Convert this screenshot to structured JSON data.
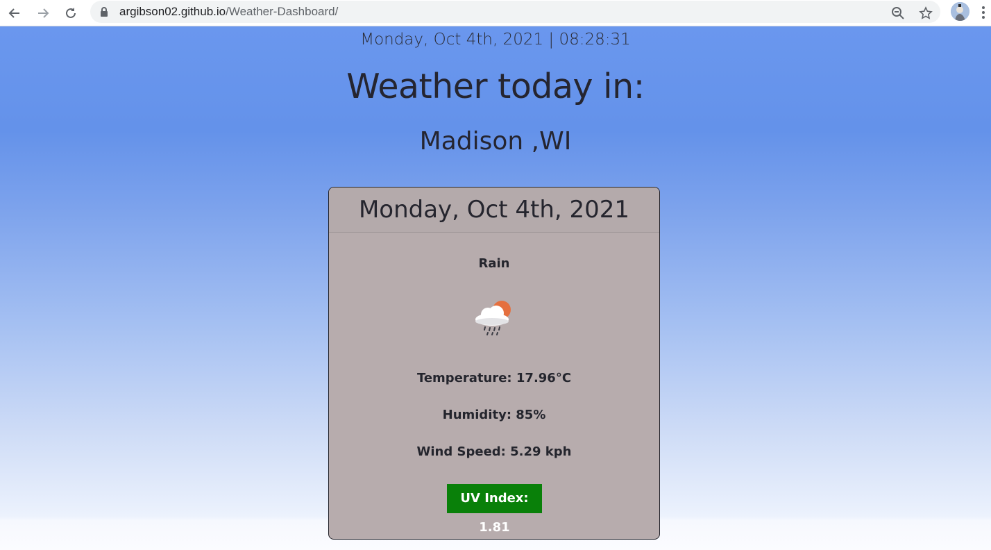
{
  "browser": {
    "url_domain": "argibson02.github.io",
    "url_path": "/Weather-Dashboard/"
  },
  "page": {
    "clock": "Monday, Oct 4th, 2021 | 08:28:31",
    "heading": "Weather today in:",
    "city": "Madison ,WI"
  },
  "card": {
    "date": "Monday, Oct 4th, 2021",
    "condition": "Rain",
    "icon": "rain-cloud-sun-icon",
    "temperature": "Temperature: 17.96°C",
    "humidity": "Humidity: 85%",
    "wind": "Wind Speed: 5.29 kph",
    "uv": "UV Index: 1.81",
    "uv_color": "#098009"
  }
}
